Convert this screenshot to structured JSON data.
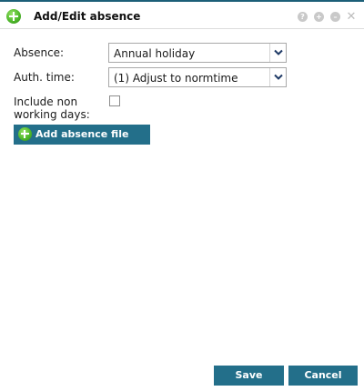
{
  "dialog": {
    "title": "Add/Edit absence",
    "controls": {
      "help": "?",
      "restore": "+",
      "minimize": "–",
      "close": "✕"
    }
  },
  "form": {
    "absence": {
      "label": "Absence:",
      "value": "Annual holiday"
    },
    "auth_time": {
      "label": "Auth. time:",
      "value": "(1) Adjust to normtime"
    },
    "include_non_working": {
      "label": "Include non working days:",
      "checked": false
    },
    "add_file_label": "Add absence file"
  },
  "footer": {
    "save_label": "Save",
    "cancel_label": "Cancel"
  },
  "colors": {
    "accent": "#236f8a",
    "title_border": "#1c5f78",
    "add_icon": "#4fb82b"
  },
  "icons": {
    "title": "add-circle-icon",
    "add_file": "add-circle-icon",
    "help": "help-icon",
    "restore": "restore-icon",
    "minimize": "minimize-icon",
    "close": "close-icon",
    "dropdown": "chevron-down-icon"
  }
}
